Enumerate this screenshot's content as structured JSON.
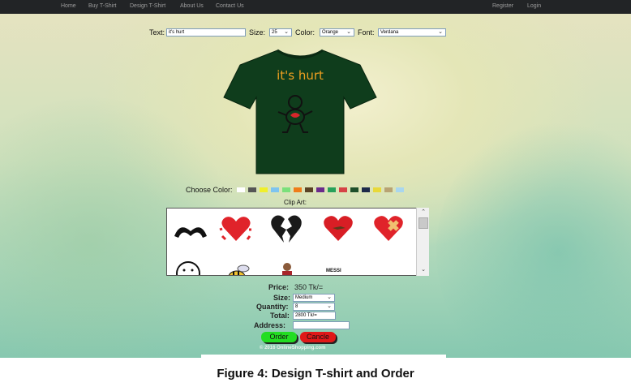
{
  "nav": {
    "left": [
      "Home",
      "Buy T-Shirt",
      "Design T-Shirt",
      "About Us",
      "Contact Us"
    ],
    "right": [
      "Register",
      "Login"
    ]
  },
  "designer": {
    "text_label": "Text:",
    "text_value": "it's hurt",
    "size_label": "Size:",
    "size_value": "25",
    "color_label": "Color:",
    "color_value": "Orange",
    "font_label": "Font:",
    "font_value": "Verdana"
  },
  "tshirt": {
    "print_text": "it's hurt",
    "shirt_color": "#0f3d1c",
    "text_color": "#f0a020"
  },
  "choose_color": {
    "label": "Choose Color:",
    "swatches": [
      "#ffffff",
      "#555555",
      "#f0ef2a",
      "#7fc4ef",
      "#7be07b",
      "#ef7d1a",
      "#5a4325",
      "#6a2b8b",
      "#28a15a",
      "#d64246",
      "#1e4f2a",
      "#1d2a4a",
      "#e8d93a",
      "#b8a373",
      "#a9d6ee"
    ]
  },
  "clip_art": {
    "label": "Clip Art:",
    "row1": [
      "hands-heart-icon",
      "hearts-icon",
      "broken-heart-icon",
      "bird-heart-icon",
      "bandaged-heart-icon"
    ],
    "row2": [
      "smiley-outline-icon",
      "bee-icon",
      "soccer-player-icon",
      "messi-icon",
      "cat-ears-icon"
    ],
    "messi_text": "MESSI"
  },
  "order": {
    "price_label": "Price:",
    "price_value": "350 Tk/=",
    "size_label": "Size:",
    "size_value": "Medium",
    "quantity_label": "Quantity:",
    "quantity_value": "8",
    "total_label": "Total:",
    "total_value": "2800 Tk/=",
    "address_label": "Address:",
    "address_value": "",
    "order_button": "Order",
    "cancel_button": "Cancle",
    "copyright": "© 2016 OnlineShopping.com"
  },
  "caption": "Figure 4: Design T-shirt and Order"
}
